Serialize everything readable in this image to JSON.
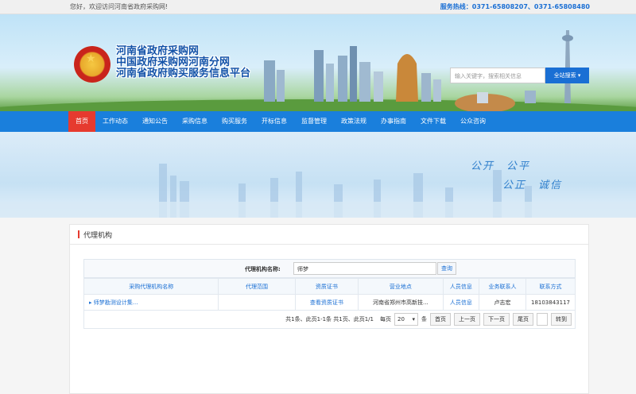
{
  "topbar": {
    "welcome": "您好，欢迎访问河南省政府采购网!",
    "hotline": "服务热线：0371-65808207、0371-65808480"
  },
  "header": {
    "title_lines": [
      "河南省政府采购网",
      "中国政府采购网河南分网",
      "河南省政府购买服务信息平台"
    ],
    "search_placeholder": "输入关键字，搜索相关信息",
    "search_button": "全站搜索"
  },
  "nav": {
    "items": [
      "首页",
      "工作动态",
      "通知公告",
      "采购信息",
      "购买服务",
      "开标信息",
      "监督管理",
      "政策法规",
      "办事指南",
      "文件下载",
      "公众咨询"
    ],
    "active_index": 0
  },
  "banner": {
    "slogan_line1": "公开　公平",
    "slogan_line2": "公正　诚信"
  },
  "panel": {
    "title": "代理机构",
    "filter_label": "代理机构名称:",
    "filter_value": "师梦",
    "query_button": "查询"
  },
  "table": {
    "headers": [
      "采购代理机构名称",
      "代理范围",
      "资质证书",
      "营业地点",
      "人员信息",
      "业务联系人",
      "联系方式"
    ],
    "rows": [
      [
        "▸ 师梦勘测设计集...",
        "",
        "查看资质证书",
        "河南省郑州市高新技...",
        "人员信息",
        "卢志宏",
        "18103843117"
      ]
    ]
  },
  "pager": {
    "summary": "共1条、此页1-1条 共1页、此页1/1",
    "per_page_label": "每页",
    "per_page_value": "20",
    "per_page_unit": "条",
    "first": "首页",
    "prev": "上一页",
    "next": "下一页",
    "last": "尾页",
    "goto": "转到"
  },
  "colors": {
    "nav_bg": "#1a7fdc",
    "nav_active": "#e63a2f",
    "link": "#1a6fd4"
  }
}
